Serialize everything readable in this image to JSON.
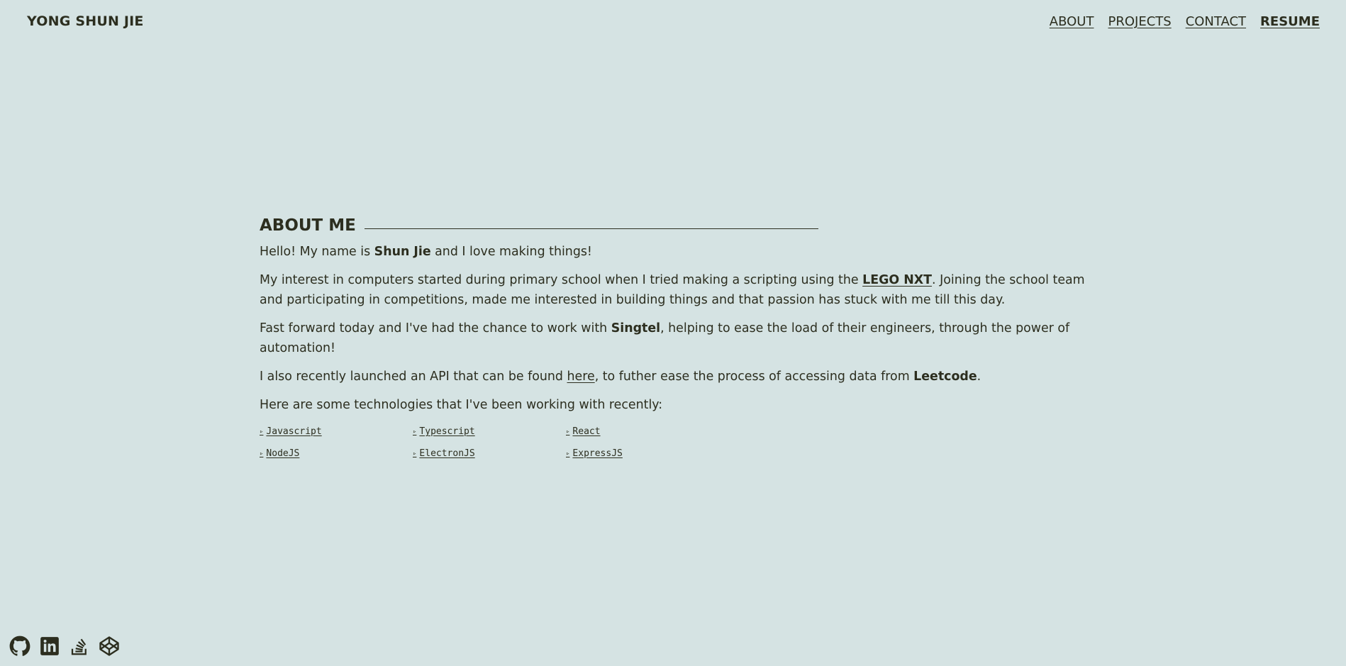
{
  "header": {
    "brand": "YONG SHUN JIE",
    "nav": [
      "ABOUT",
      "PROJECTS",
      "CONTACT",
      "RESUME"
    ]
  },
  "about": {
    "title": "ABOUT ME",
    "p1": {
      "a": "Hello! My name is ",
      "name": "Shun Jie",
      "b": " and I love making things!"
    },
    "p2": {
      "a": "My interest in computers started during primary school when I tried making a scripting using the ",
      "link": "LEGO NXT",
      "b": ". Joining the school team and participating in competitions, made me interested in building things and that passion has stuck with me till this day."
    },
    "p3": {
      "a": "Fast forward today and I've had the chance to work with ",
      "company": "Singtel",
      "b": ", helping to ease the load of their engineers, through the power of automation!"
    },
    "p4": {
      "a": "I also recently launched an API that can be found ",
      "link": "here",
      "b": ", to futher ease the process of accessing data from ",
      "site": "Leetcode",
      "c": "."
    },
    "p5": "Here are some technologies that I've been working with recently:",
    "tech_marker": "▹",
    "technologies": [
      "Javascript",
      "Typescript",
      "React",
      "NodeJS",
      "ElectronJS",
      "ExpressJS"
    ]
  },
  "socials": {
    "icons": [
      "github-icon",
      "linkedin-icon",
      "stackoverflow-icon",
      "codepen-icon"
    ]
  },
  "colors": {
    "background": "#d5e3e3",
    "text": "#2c2e1f"
  }
}
